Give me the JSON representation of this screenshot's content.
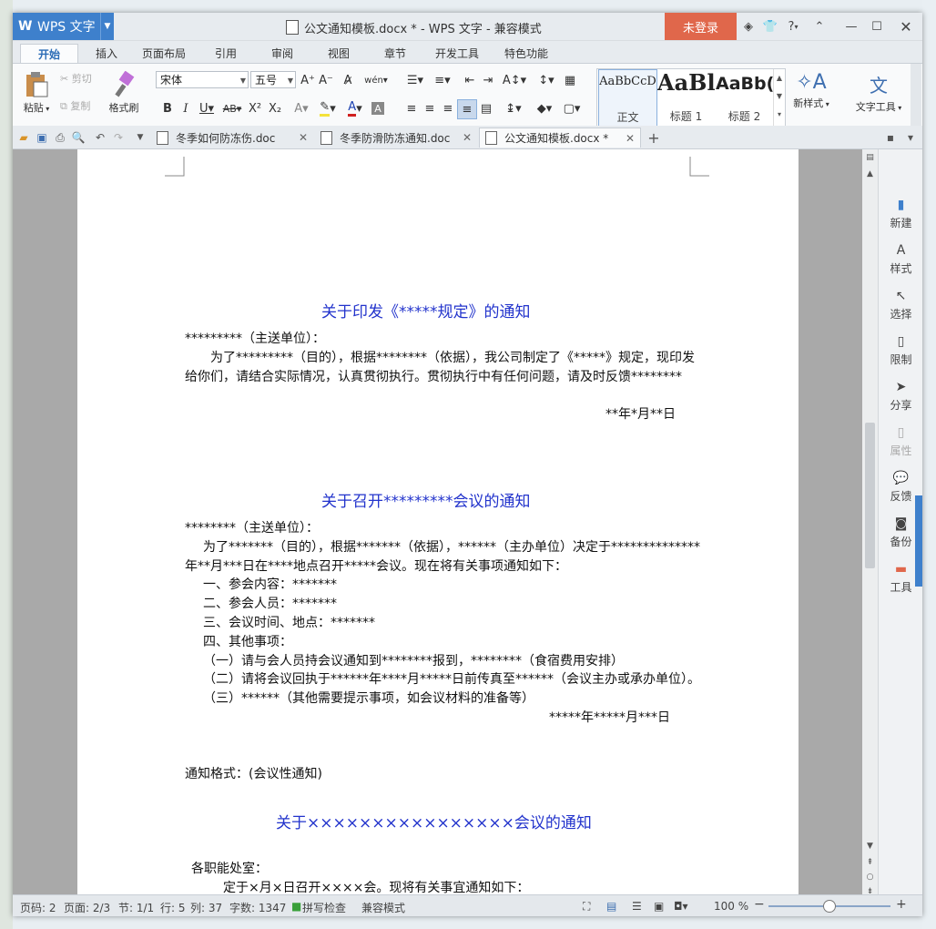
{
  "app": {
    "name": "WPS 文字",
    "title": "公文通知模板.docx * - WPS 文字 - 兼容模式",
    "login": "未登录",
    "help": "?"
  },
  "ribbon_tabs": [
    "开始",
    "插入",
    "页面布局",
    "引用",
    "审阅",
    "视图",
    "章节",
    "开发工具",
    "特色功能"
  ],
  "ribbon": {
    "paste": "粘贴",
    "cut": "剪切",
    "copy": "复制",
    "format_painter": "格式刷",
    "font_name": "宋体",
    "font_size": "五号",
    "styles": [
      {
        "sample": "AaBbCcD",
        "label": "正文"
      },
      {
        "sample": "AaBl",
        "label": "标题 1"
      },
      {
        "sample": "AaBb(",
        "label": "标题 2"
      }
    ],
    "new_style": "新样式",
    "text_tools": "文字工具"
  },
  "doc_tabs": [
    {
      "name": "冬季如何防冻伤.doc",
      "active": false
    },
    {
      "name": "冬季防滑防冻通知.doc",
      "active": false
    },
    {
      "name": "公文通知模板.docx *",
      "active": true
    }
  ],
  "document": {
    "heading1": "关于印发《*****规定》的通知",
    "p1_to": "*********（主送单位）：",
    "p1_line1": "为了*********（目的），根据********（依据），我公司制定了《*****》规定，现印发",
    "p1_line2": "给你们，请结合实际情况，认真贯彻执行。贯彻执行中有任何问题，请及时反馈********",
    "p1_date": "**年*月**日",
    "heading2": "关于召开*********会议的通知",
    "p2_to": "********（主送单位）：",
    "p2_line1": "为了*******（目的），根据*******（依据），******（主办单位）决定于**************",
    "p2_line2": "年**月***日在****地点召开*****会议。现在将有关事项通知如下：",
    "p2_items": [
      "一、参会内容：*******",
      "二、参会人员：*******",
      "三、会议时间、地点：*******",
      "四、其他事项：",
      "（一）请与会人员持会议通知到********报到，********（食宿费用安排）",
      "（二）请将会议回执于******年****月*****日前传真至******（会议主办或承办单位）。",
      "（三）******（其他需要提示事项，如会议材料的准备等）"
    ],
    "p2_date": "*****年*****月***日",
    "format_note": "通知格式：(会议性通知)",
    "heading3": "关于××××××××××××××××会议的通知",
    "p3_to": "各职能处室：",
    "p3_line1": "定于×月×日召开××××会。现将有关事宜通知如下："
  },
  "task_pane": [
    "新建",
    "样式",
    "选择",
    "限制",
    "分享",
    "属性",
    "反馈",
    "备份",
    "工具"
  ],
  "status": {
    "page_code": "页码: 2",
    "pages": "页面: 2/3",
    "section": "节: 1/1",
    "row": "行: 5",
    "col": "列: 37",
    "word_count": "字数: 1347",
    "spell_check": "拼写检查",
    "compat_mode": "兼容模式",
    "zoom": "100 %"
  },
  "colors": {
    "brand_blue": "#3e80cc",
    "login_red": "#e0674b",
    "heading_blue": "#2233cc"
  }
}
